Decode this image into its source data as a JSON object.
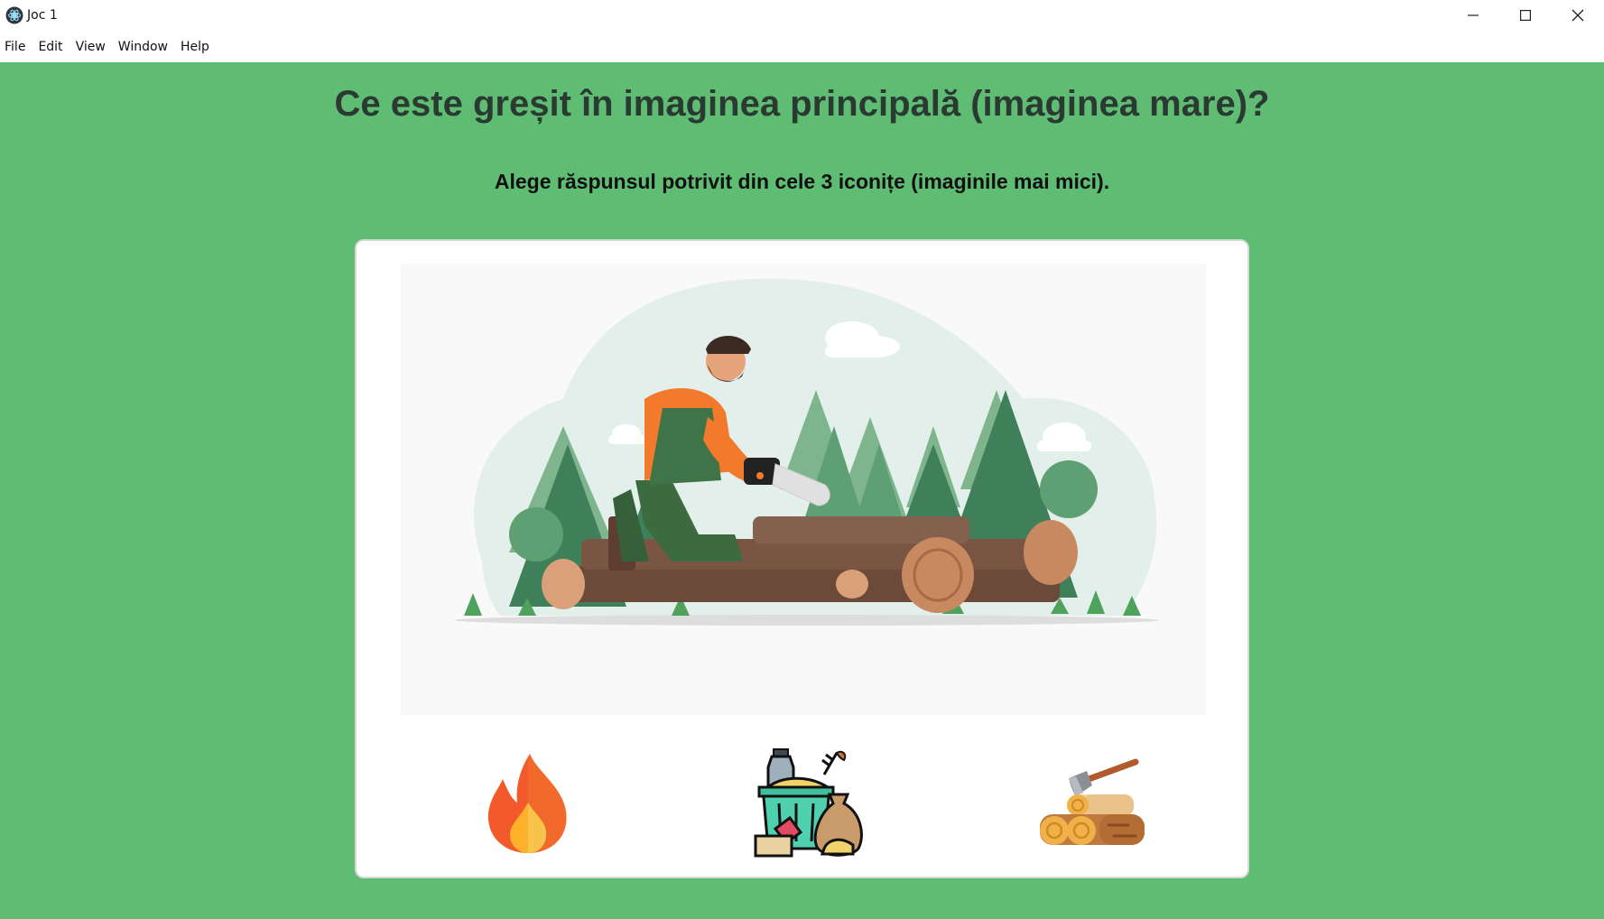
{
  "window": {
    "title": "Joc 1",
    "icon": "electron-app-icon"
  },
  "menu": [
    "File",
    "Edit",
    "View",
    "Window",
    "Help"
  ],
  "colors": {
    "background": "#5fbc73",
    "card": "#ffffff",
    "title_text": "#2a3a33"
  },
  "quiz": {
    "question": "Ce este greșit în imaginea principală (imaginea mare)?",
    "instruction": "Alege răspunsul potrivit din cele 3 iconițe (imaginile mai mici).",
    "main_image": "illustration: lumberjack cutting logs with a chainsaw in a forest",
    "options": [
      {
        "icon": "fire-icon"
      },
      {
        "icon": "waste-trash-bin-icon"
      },
      {
        "icon": "logs-with-axe-icon"
      }
    ]
  }
}
